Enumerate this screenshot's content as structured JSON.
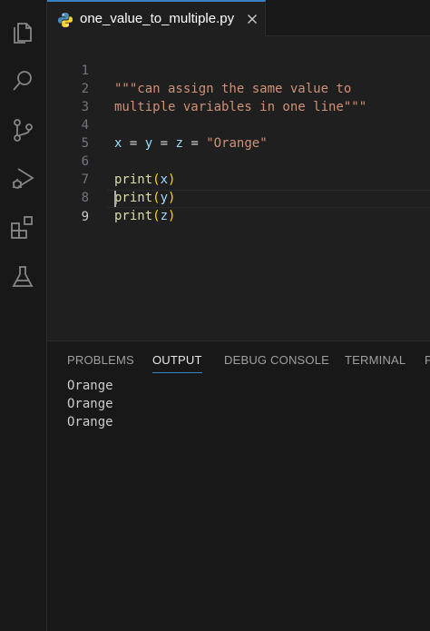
{
  "tab": {
    "filename": "one_value_to_multiple.py"
  },
  "activity_bar": {
    "icons": [
      "files-icon",
      "search-icon",
      "source-control-icon",
      "run-debug-icon",
      "extensions-icon",
      "testing-flask-icon"
    ]
  },
  "editor": {
    "line_numbers": [
      "1",
      "2",
      "3",
      "4",
      "5",
      "6",
      "7",
      "8",
      "9"
    ],
    "lines": {
      "l1": "\"\"\"can assign the same value to",
      "l2": "multiple variables in one line\"\"\"",
      "l4_var1": "x",
      "l4_eq1": " = ",
      "l4_var2": "y",
      "l4_eq2": " = ",
      "l4_var3": "z",
      "l4_eq3": " = ",
      "l4_str": "\"Orange\"",
      "print_fn": "print",
      "l6_arg": "x",
      "l7_arg": "y",
      "l8_arg": "z",
      "open_paren": "(",
      "close_paren": ")"
    },
    "current_line": "9"
  },
  "panel": {
    "tabs": [
      "PROBLEMS",
      "OUTPUT",
      "DEBUG CONSOLE",
      "TERMINAL",
      "P"
    ],
    "active_tab": "OUTPUT",
    "output": [
      "Orange",
      "Orange",
      "Orange"
    ]
  },
  "colors": {
    "accent": "#3b82c4",
    "string": "#ce9178",
    "function": "#dcdcaa",
    "variable": "#9cdcfe",
    "bracket": "#ffd700"
  }
}
